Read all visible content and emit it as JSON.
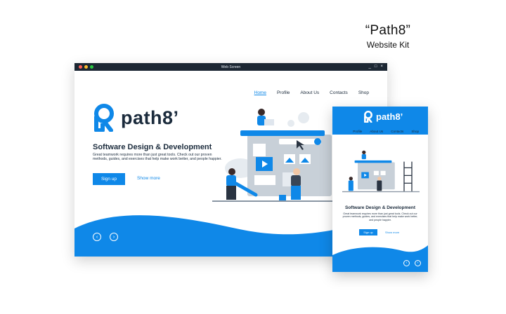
{
  "kit": {
    "name": "“Path8”",
    "subtitle": "Website Kit"
  },
  "desktop": {
    "window_title": "Web Screen",
    "nav": [
      {
        "label": "Home",
        "active": true
      },
      {
        "label": "Profile",
        "active": false
      },
      {
        "label": "About Us",
        "active": false
      },
      {
        "label": "Contacts",
        "active": false
      },
      {
        "label": "Shop",
        "active": false
      }
    ],
    "logo_text": "path8’",
    "heading": "Software Design & Development",
    "body": "Great teamwork requires more than just great tools. Check out our proven methods, guides, and exercises that help make work better, and people happier.",
    "signup_label": "Sign up",
    "more_label": "Show more",
    "prev_icon": "chevron-left-icon",
    "next_icon": "chevron-right-icon"
  },
  "mobile": {
    "logo_text": "path8’",
    "nav": [
      {
        "label": "Home",
        "active": true
      },
      {
        "label": "Profile",
        "active": false
      },
      {
        "label": "About Us",
        "active": false
      },
      {
        "label": "Contacts",
        "active": false
      },
      {
        "label": "Shop",
        "active": false
      }
    ],
    "heading": "Software Design & Development",
    "body": "Great teamwork requires more than just great tools. Check out our proven methods, guides, and exercises that help make work better, and people happier.",
    "signup_label": "Sign up",
    "more_label": "Show more"
  },
  "colors": {
    "accent": "#0f88e8",
    "dark": "#1b2b3c",
    "titlebar": "#1c2733"
  }
}
